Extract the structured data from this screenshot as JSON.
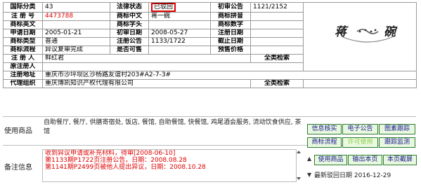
{
  "info": {
    "labels": {
      "class": "国际分类",
      "reg_no": "注 册 号",
      "en": "商标英文",
      "apply_date": "申请日期",
      "type": "商标类型",
      "flow": "商标流程",
      "registrant": "注 册 人",
      "orig_registrant": "原注册人",
      "address": "注册地址",
      "agent": "代理组织",
      "legal_status": "法律状态",
      "cn": "商标中文",
      "shape": "商标字头",
      "prelim_date": "初审日期",
      "reg_notice": "注册公告",
      "for_sale": "是否可售",
      "prelim_notice": "初审公告",
      "pinyin": "商标拼音",
      "digits": "商标数字",
      "reg_date": "注册日期",
      "expire_date": "截止日期",
      "presale_price": "预售价格"
    },
    "values": {
      "class": "43",
      "reg_no": "4473788",
      "en": "",
      "apply_date": "2005-01-21",
      "type": "普通",
      "flow": "异议复审完成",
      "registrant": "鲜红君",
      "orig_registrant": "",
      "address": "重庆市沙坪坝区沙杨路友谊村203#A2-7-3#",
      "agent": "重庆博凯知识产权代理有限公司",
      "legal_status": "已驳回",
      "cn": "蒋一碗",
      "shape": "",
      "prelim_date": "2008-05-27",
      "reg_notice": "1133/1722",
      "for_sale": "",
      "prelim_notice": "1121/2152",
      "pinyin": "",
      "digits": "",
      "reg_date": "",
      "expire_date": "",
      "presale_price": ""
    },
    "search_label": "全类检索"
  },
  "logo_text": "蒋碗",
  "goods": {
    "label": "使用商品",
    "text": "自助餐厅, 餐厅, 供膳寄宿处, 饭店, 餐馆, 自助餐馆, 快餐馆, 鸡尾酒会服务, 流动饮食供应, 茶馆"
  },
  "notes": {
    "label": "备注信息",
    "lines": [
      "收到异议申请或补充材料，待审[2008-06-10]",
      "第1133期P1722页注册公告，日期：2008.08.28",
      "第1141期P2499页被他人提出异议，日期：2008.10.28"
    ]
  },
  "buttons": [
    {
      "label": "信息核实",
      "disabled": false
    },
    {
      "label": "电子公告",
      "disabled": false
    },
    {
      "label": "图素跟踪",
      "disabled": false
    },
    {
      "label": "商标流程",
      "disabled": false
    },
    {
      "label": "许可使用",
      "disabled": true
    },
    {
      "label": "跟踪监测",
      "disabled": false
    },
    {
      "label": "使用商品",
      "disabled": false
    },
    {
      "label": "输出本页",
      "disabled": false
    },
    {
      "label": "本页截屏",
      "disabled": false
    }
  ],
  "latest": {
    "label": "最新驳回日期",
    "date": "2016-12-29"
  },
  "colors": {
    "red": "#e00000",
    "button_border": "#2e7d2e",
    "button_bg": "#e8f7e0",
    "link": "#1a1a8c",
    "disabled": "#8fcf4f"
  }
}
